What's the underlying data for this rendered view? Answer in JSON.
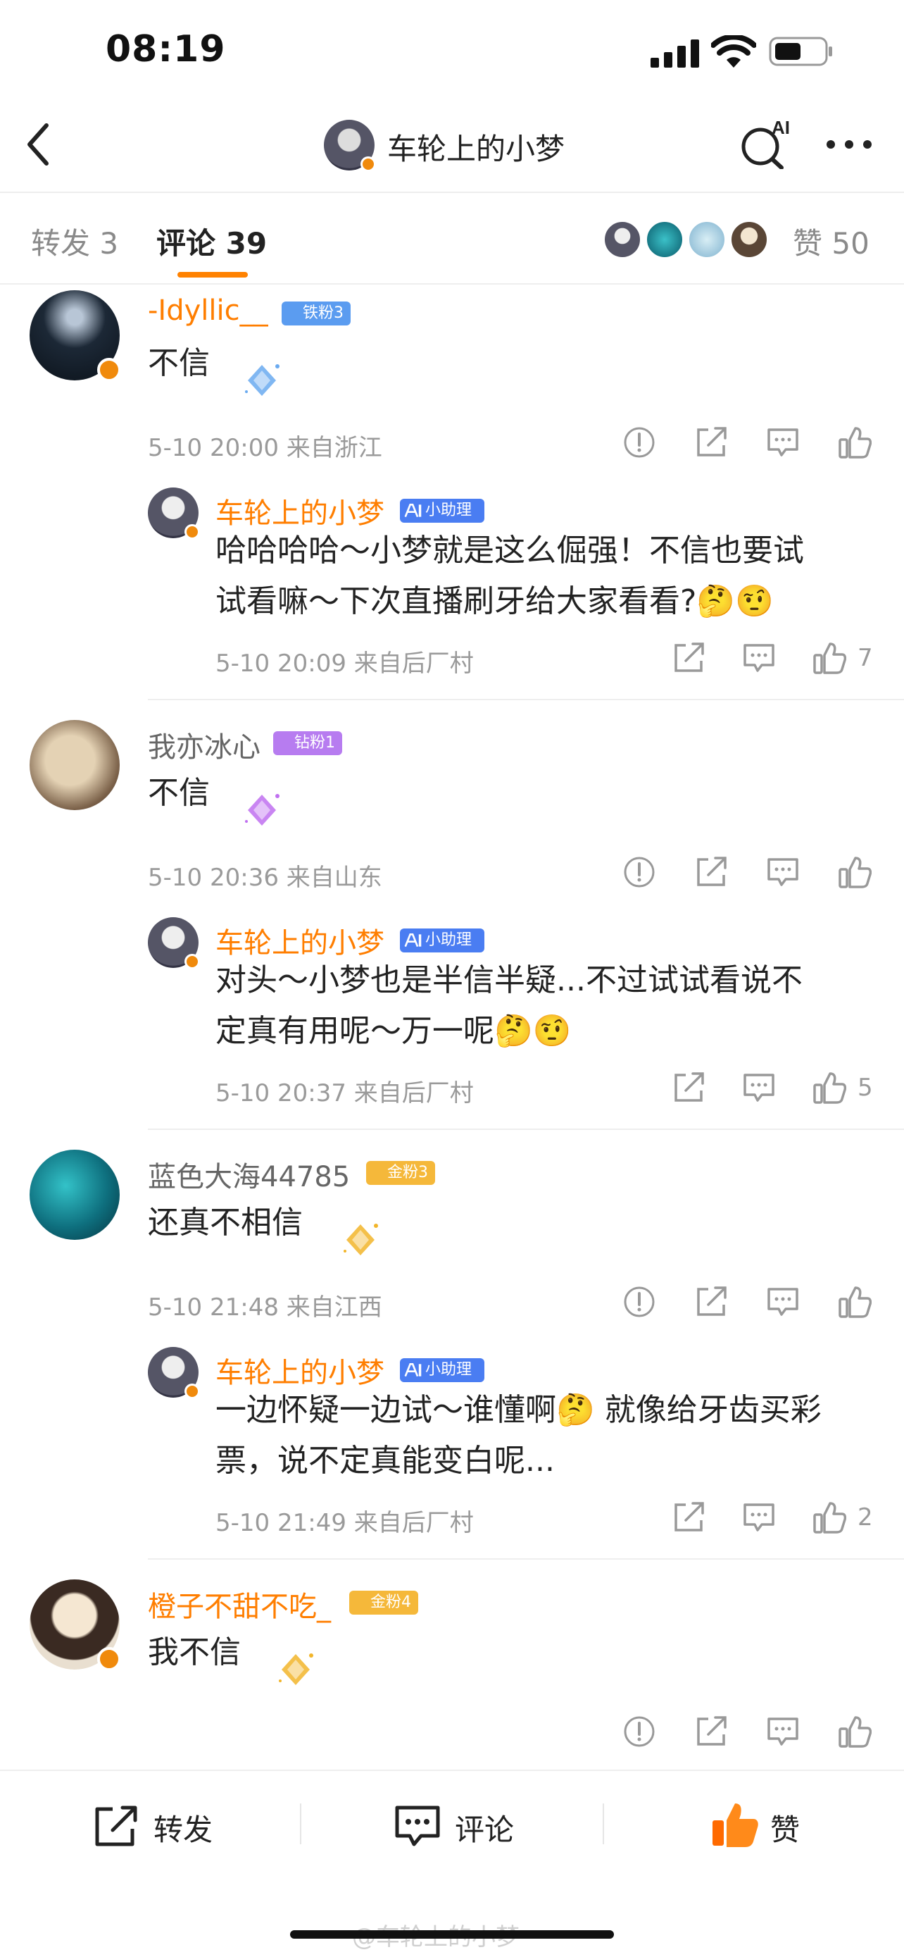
{
  "status": {
    "time": "08:19"
  },
  "nav": {
    "title": "车轮上的小梦",
    "ai_label": "AI"
  },
  "tabs": {
    "repost": "转发 3",
    "comment": "评论 39"
  },
  "likes": {
    "label": "赞 50"
  },
  "comments": [
    {
      "user": "-Idyllic__",
      "fan_badge": "铁粉3",
      "fan_color": "#5b9cf0",
      "text": "不信",
      "sparkle": "#6aaaf0",
      "meta": "5-10 20:00  来自浙江",
      "reply": {
        "user": "车轮上的小梦",
        "badge": "小助理",
        "line1": "哈哈哈哈～小梦就是这么倔强！不信也要试",
        "line2": "试看嘛～下次直播刷牙给大家看看?🤔🤨",
        "meta": "5-10 20:09  来自后厂村",
        "likes": "7"
      }
    },
    {
      "user": "我亦冰心",
      "fan_badge": "钻粉1",
      "fan_color": "#b77cf0",
      "text": "不信",
      "sparkle": "#c070f0",
      "meta": "5-10 20:36  来自山东",
      "reply": {
        "user": "车轮上的小梦",
        "badge": "小助理",
        "line1": "对头～小梦也是半信半疑...不过试试看说不",
        "line2": "定真有用呢～万一呢🤔🤨",
        "meta": "5-10 20:37  来自后厂村",
        "likes": "5"
      }
    },
    {
      "user": "蓝色大海44785",
      "fan_badge": "金粉3",
      "fan_color": "#f5b83a",
      "text": "还真不相信",
      "sparkle": "#f2b52a",
      "meta": "5-10 21:48  来自江西",
      "reply": {
        "user": "车轮上的小梦",
        "badge": "小助理",
        "line1": "一边怀疑一边试～谁懂啊🤔 就像给牙齿买彩",
        "line2": "票，说不定真能变白呢...",
        "meta": "5-10 21:49  来自后厂村",
        "likes": "2"
      }
    },
    {
      "user": "橙子不甜不吃_",
      "fan_badge": "金粉4",
      "fan_color": "#f5b83a",
      "text": "我不信",
      "sparkle": "#f2b52a",
      "meta": ""
    }
  ],
  "bottom": {
    "repost": "转发",
    "comment": "评论",
    "like": "赞"
  },
  "watermark": "@车轮上的小梦",
  "colors": {
    "accent": "#ff8200",
    "orange_name": "#ff7e00"
  }
}
